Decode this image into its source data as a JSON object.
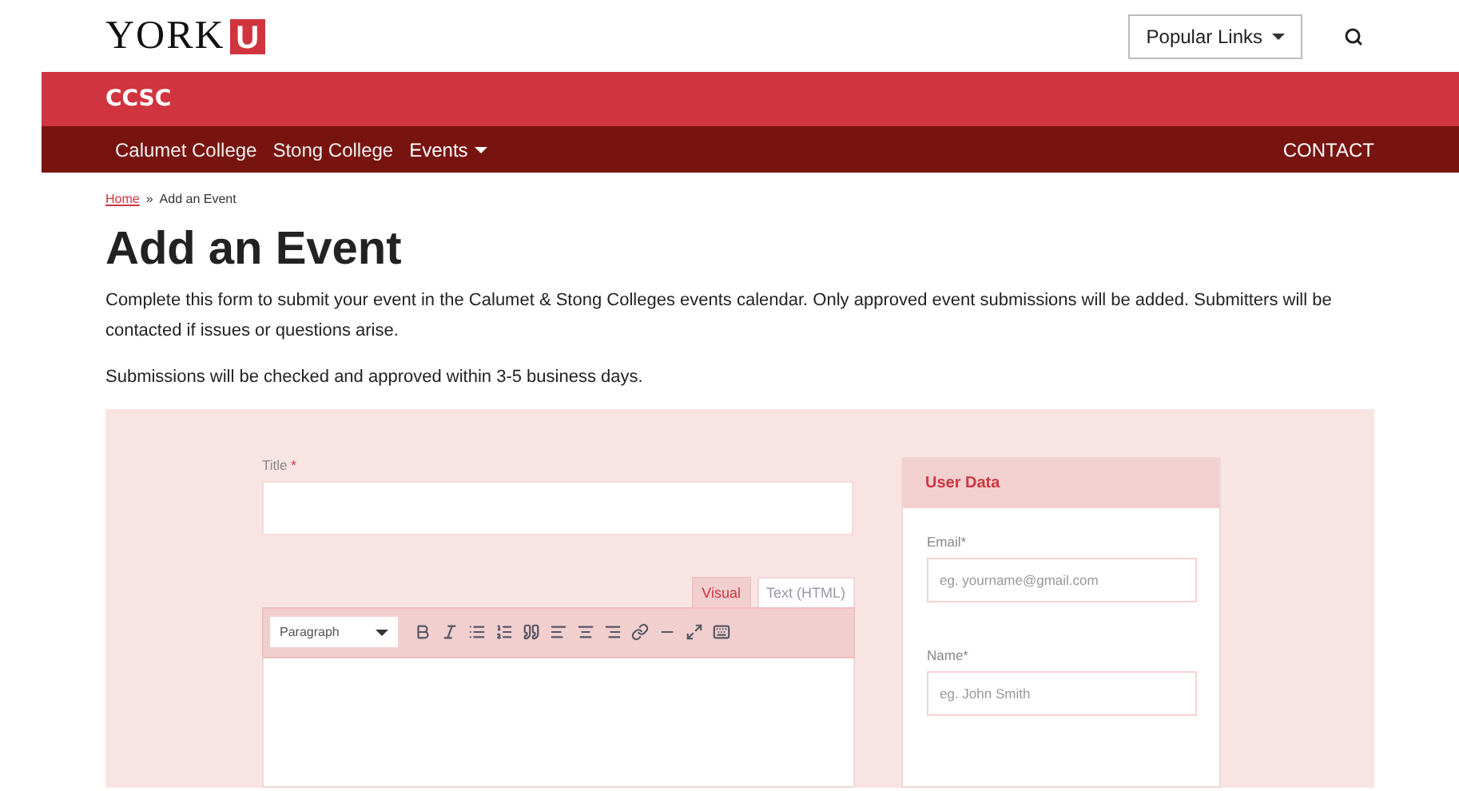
{
  "header": {
    "logo_text": "YORK",
    "logo_mark": "U",
    "popular_links": "Popular Links"
  },
  "site_bar": {
    "title": "CCSC"
  },
  "nav": {
    "items": [
      {
        "label": "Calumet College",
        "dropdown": false
      },
      {
        "label": "Stong College",
        "dropdown": false
      },
      {
        "label": "Events",
        "dropdown": true
      }
    ],
    "contact": "CONTACT"
  },
  "breadcrumb": {
    "home": "Home",
    "separator": "»",
    "current": "Add an Event"
  },
  "page_title": "Add an Event",
  "intro": [
    "Complete this form to submit your event in the Calumet & Stong Colleges events calendar. Only approved event submissions will be added. Submitters will be contacted if issues or questions arise.",
    "Submissions will be checked and approved within 3-5 business days."
  ],
  "form": {
    "title_label": "Title",
    "required_mark": "*",
    "editor_tabs": [
      {
        "label": "Visual",
        "selected": true
      },
      {
        "label": "Text (HTML)",
        "selected": false
      }
    ],
    "format_select": "Paragraph"
  },
  "user_data": {
    "title": "User Data",
    "fields": [
      {
        "label": "Email*",
        "placeholder": "eg. yourname@gmail.com"
      },
      {
        "label": "Name*",
        "placeholder": "eg. John Smith"
      }
    ]
  }
}
